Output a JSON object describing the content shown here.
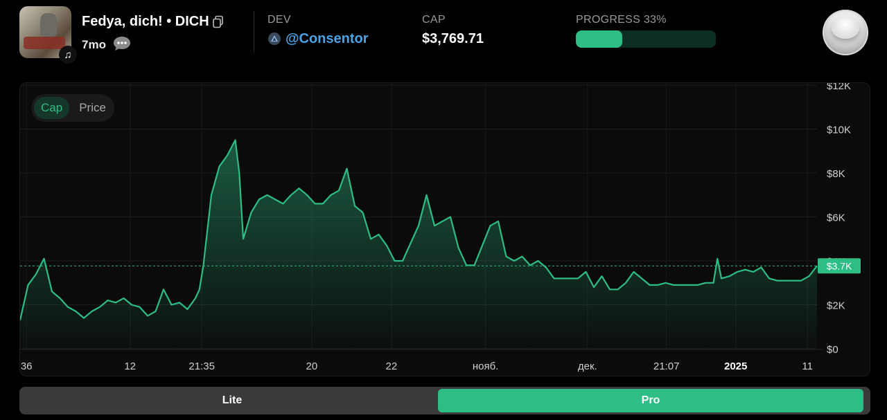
{
  "token": {
    "title": "Fedya, dich! • DICH",
    "age": "7mo"
  },
  "stats": {
    "dev_label": "DEV",
    "dev_name": "@Consentor",
    "cap_label": "CAP",
    "cap_value": "$3,769.71",
    "progress_label": "PROGRESS 33%",
    "progress_value": 0.33
  },
  "chart_toggle": {
    "cap": "Cap",
    "price": "Price",
    "selected": "Cap"
  },
  "modes": {
    "lite": "Lite",
    "pro": "Pro",
    "selected": "Pro"
  },
  "colors": {
    "accent": "#2ebd85",
    "dev_link": "#4aa3e3"
  },
  "icons": [
    "music-note-icon",
    "copy-icon",
    "chat-icon",
    "dev-avatar-icon"
  ],
  "chart_data": {
    "type": "area",
    "ylim": [
      0,
      12000
    ],
    "yticks": [
      {
        "value": 12000,
        "label": "$12K"
      },
      {
        "value": 10000,
        "label": "$10K"
      },
      {
        "value": 8000,
        "label": "$8K"
      },
      {
        "value": 6000,
        "label": "$6K"
      },
      {
        "value": 4000,
        "label": "$4K"
      },
      {
        "value": 2000,
        "label": "$2K"
      },
      {
        "value": 0,
        "label": "$0"
      }
    ],
    "xticks": [
      {
        "pos": 0.008,
        "label": "36",
        "bold": false
      },
      {
        "pos": 0.138,
        "label": "12",
        "bold": false
      },
      {
        "pos": 0.228,
        "label": "21:35",
        "bold": false
      },
      {
        "pos": 0.366,
        "label": "20",
        "bold": false
      },
      {
        "pos": 0.466,
        "label": "22",
        "bold": false
      },
      {
        "pos": 0.584,
        "label": "нояб.",
        "bold": false
      },
      {
        "pos": 0.712,
        "label": "дек.",
        "bold": false
      },
      {
        "pos": 0.811,
        "label": "21:07",
        "bold": false
      },
      {
        "pos": 0.898,
        "label": "2025",
        "bold": true
      },
      {
        "pos": 0.988,
        "label": "11",
        "bold": false
      }
    ],
    "current": {
      "value": 3769.71,
      "label": "$3.7K"
    },
    "x": [
      0,
      0.01,
      0.02,
      0.03,
      0.04,
      0.05,
      0.06,
      0.07,
      0.08,
      0.09,
      0.1,
      0.11,
      0.12,
      0.13,
      0.14,
      0.15,
      0.16,
      0.17,
      0.18,
      0.19,
      0.2,
      0.21,
      0.22,
      0.225,
      0.23,
      0.24,
      0.25,
      0.26,
      0.27,
      0.275,
      0.28,
      0.29,
      0.3,
      0.31,
      0.32,
      0.33,
      0.34,
      0.35,
      0.36,
      0.37,
      0.38,
      0.39,
      0.4,
      0.41,
      0.42,
      0.43,
      0.44,
      0.45,
      0.46,
      0.47,
      0.48,
      0.49,
      0.5,
      0.51,
      0.52,
      0.53,
      0.54,
      0.55,
      0.56,
      0.57,
      0.58,
      0.59,
      0.6,
      0.61,
      0.62,
      0.63,
      0.64,
      0.65,
      0.66,
      0.67,
      0.68,
      0.69,
      0.7,
      0.71,
      0.72,
      0.73,
      0.74,
      0.75,
      0.76,
      0.77,
      0.78,
      0.79,
      0.8,
      0.81,
      0.82,
      0.83,
      0.84,
      0.85,
      0.86,
      0.87,
      0.875,
      0.88,
      0.89,
      0.9,
      0.91,
      0.92,
      0.93,
      0.94,
      0.95,
      0.96,
      0.97,
      0.98,
      0.99,
      1.0
    ],
    "y": [
      1300,
      2900,
      3400,
      4100,
      2600,
      2300,
      1900,
      1700,
      1400,
      1700,
      1900,
      2200,
      2100,
      2300,
      2000,
      1900,
      1500,
      1700,
      2700,
      2000,
      2100,
      1800,
      2300,
      2700,
      3800,
      7000,
      8300,
      8800,
      9500,
      8000,
      5000,
      6200,
      6800,
      7000,
      6800,
      6600,
      7000,
      7300,
      7000,
      6600,
      6600,
      7000,
      7200,
      8200,
      6500,
      6200,
      5000,
      5200,
      4700,
      4000,
      4000,
      4800,
      5600,
      7000,
      5600,
      5800,
      6000,
      4600,
      3800,
      3800,
      4700,
      5600,
      5800,
      4200,
      4000,
      4200,
      3800,
      4000,
      3700,
      3200,
      3200,
      3200,
      3200,
      3500,
      2800,
      3300,
      2700,
      2700,
      3000,
      3500,
      3200,
      2900,
      2900,
      3000,
      2900,
      2900,
      2900,
      2900,
      3000,
      3000,
      4100,
      3200,
      3300,
      3500,
      3600,
      3500,
      3700,
      3200,
      3100,
      3100,
      3100,
      3100,
      3300,
      3769.71
    ]
  }
}
